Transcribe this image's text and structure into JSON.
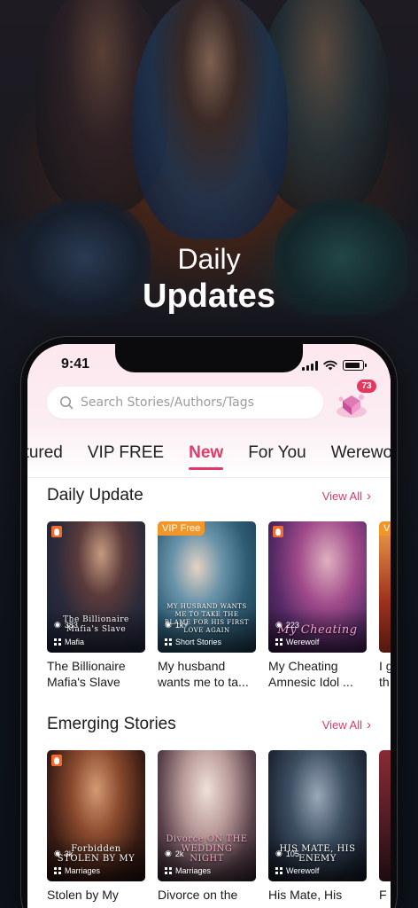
{
  "hero": {
    "line1": "Daily",
    "line2": "Updates"
  },
  "status_bar": {
    "time": "9:41"
  },
  "search": {
    "placeholder": "Search Stories/Authors/Tags"
  },
  "gift": {
    "badge_count": "73"
  },
  "tabs": [
    {
      "label": "Featured",
      "visible_text": "atured",
      "active": false
    },
    {
      "label": "VIP FREE",
      "active": false
    },
    {
      "label": "New",
      "active": true
    },
    {
      "label": "For You",
      "active": false
    },
    {
      "label": "Werewolf",
      "visible_text": "Werewo",
      "active": false
    }
  ],
  "daily_update": {
    "title": "Daily Update",
    "view_all": "View All",
    "books": [
      {
        "title_line1": "The Billionaire",
        "title_line2": "Mafia's Slave",
        "views": "383",
        "genre": "Mafia",
        "badge": "flame",
        "cover_text": "The Billionaire Mafia's Slave"
      },
      {
        "title_line1": "My husband",
        "title_line2": "wants me to ta...",
        "views": "1k+",
        "genre": "Short Stories",
        "badge": "VIP Free",
        "cover_text": "MY HUSBAND WANTS ME TO TAKE THE BLAME FOR HIS FIRST LOVE AGAIN"
      },
      {
        "title_line1": "My Cheating",
        "title_line2": "Amnesic Idol ...",
        "views": "223",
        "genre": "Werewolf",
        "badge": "flame",
        "cover_text": "My Cheating"
      },
      {
        "title_line1": "I g",
        "title_line2": "th",
        "views": "",
        "genre": "",
        "badge": "V",
        "cover_text": ""
      }
    ]
  },
  "emerging": {
    "title": "Emerging Stories",
    "view_all": "View All",
    "books": [
      {
        "title_line1": "Stolen by My",
        "title_line2": "",
        "views": "3k",
        "genre": "Marriages",
        "badge": "flame",
        "cover_text": "Forbidden STOLEN BY MY"
      },
      {
        "title_line1": "Divorce on the",
        "title_line2": "",
        "views": "2k",
        "genre": "Marriages",
        "badge": "",
        "cover_text": "Divorce ON THE WEDDING NIGHT"
      },
      {
        "title_line1": "His Mate, His",
        "title_line2": "",
        "views": "105",
        "genre": "Werewolf",
        "badge": "",
        "cover_text": "HIS MATE, HIS ENEMY"
      },
      {
        "title_line1": "F",
        "title_line2": "",
        "views": "",
        "genre": "",
        "badge": "",
        "cover_text": ""
      }
    ]
  }
}
